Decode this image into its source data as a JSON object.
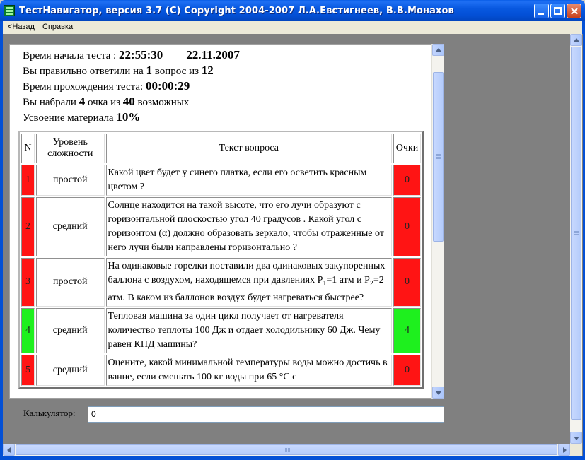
{
  "window": {
    "title": "ТестНавигатор, версия 3.7 (C) Copyright 2004-2007  Л.А.Евстигнеев, В.В.Монахов",
    "close_glyph": "×"
  },
  "menu": {
    "back_label": "<Назад",
    "help_label": "Справка"
  },
  "summary": {
    "start_label": "Время начала теста : ",
    "start_time": "22:55:30",
    "start_date": "22.11.2007",
    "correct_prefix": "Вы правильно ответили на ",
    "correct_count": "1",
    "correct_middle": " вопрос из ",
    "total_questions": "12",
    "duration_label": "Время прохождения теста: ",
    "duration": "00:00:29",
    "score_prefix": "Вы набрали ",
    "score": "4",
    "score_middle": " очка из ",
    "score_max": "40",
    "score_suffix": " возможных",
    "mastery_label": "Усвоение материала ",
    "mastery": "10%"
  },
  "table": {
    "headers": {
      "n": "N",
      "level": "Уровень сложности",
      "text": "Текст вопроса",
      "points": "Очки"
    },
    "rows": [
      {
        "n": "1",
        "level": "простой",
        "text": "Какой цвет будет у синего платка, если его осветить красным цветом ?",
        "points": "0",
        "status": "wrong"
      },
      {
        "n": "2",
        "level": "средний",
        "text": "Солнце находится на такой высоте, что его лучи образуют с горизонтальной плоскостью угол 40 градусов . Какой угол с горизонтом (α) должно образовать зеркало, чтобы отраженные от него лучи были направлены горизонтально ?",
        "points": "0",
        "status": "wrong"
      },
      {
        "n": "3",
        "level": "простой",
        "text_a": "На одинаковые горелки поставили два одинаковых закупоренных баллона с воздухом, находящемся при давлениях P",
        "sub1": "1",
        "text_b": "=1 атм и P",
        "sub2": "2",
        "text_c": "=2 атм. В каком из баллонов воздух будет нагреваться быстрее?",
        "points": "0",
        "status": "wrong"
      },
      {
        "n": "4",
        "level": "средний",
        "text": "Тепловая машина за один цикл получает от нагревателя количество теплоты 100 Дж и отдает холодильнику 60 Дж. Чему равен КПД машины?",
        "points": "4",
        "status": "correct"
      },
      {
        "n": "5",
        "level": "средний",
        "text": "Оцените, какой минимальной температуры воды можно достичь в ванне, если смешать 100 кг воды при 65 °С с",
        "points": "0",
        "status": "wrong"
      }
    ]
  },
  "calculator": {
    "label": "Калькулятор:",
    "value": "0"
  },
  "colors": {
    "wrong": "#ff1414",
    "correct": "#1ef01e",
    "titlebar": "#0350d6"
  }
}
